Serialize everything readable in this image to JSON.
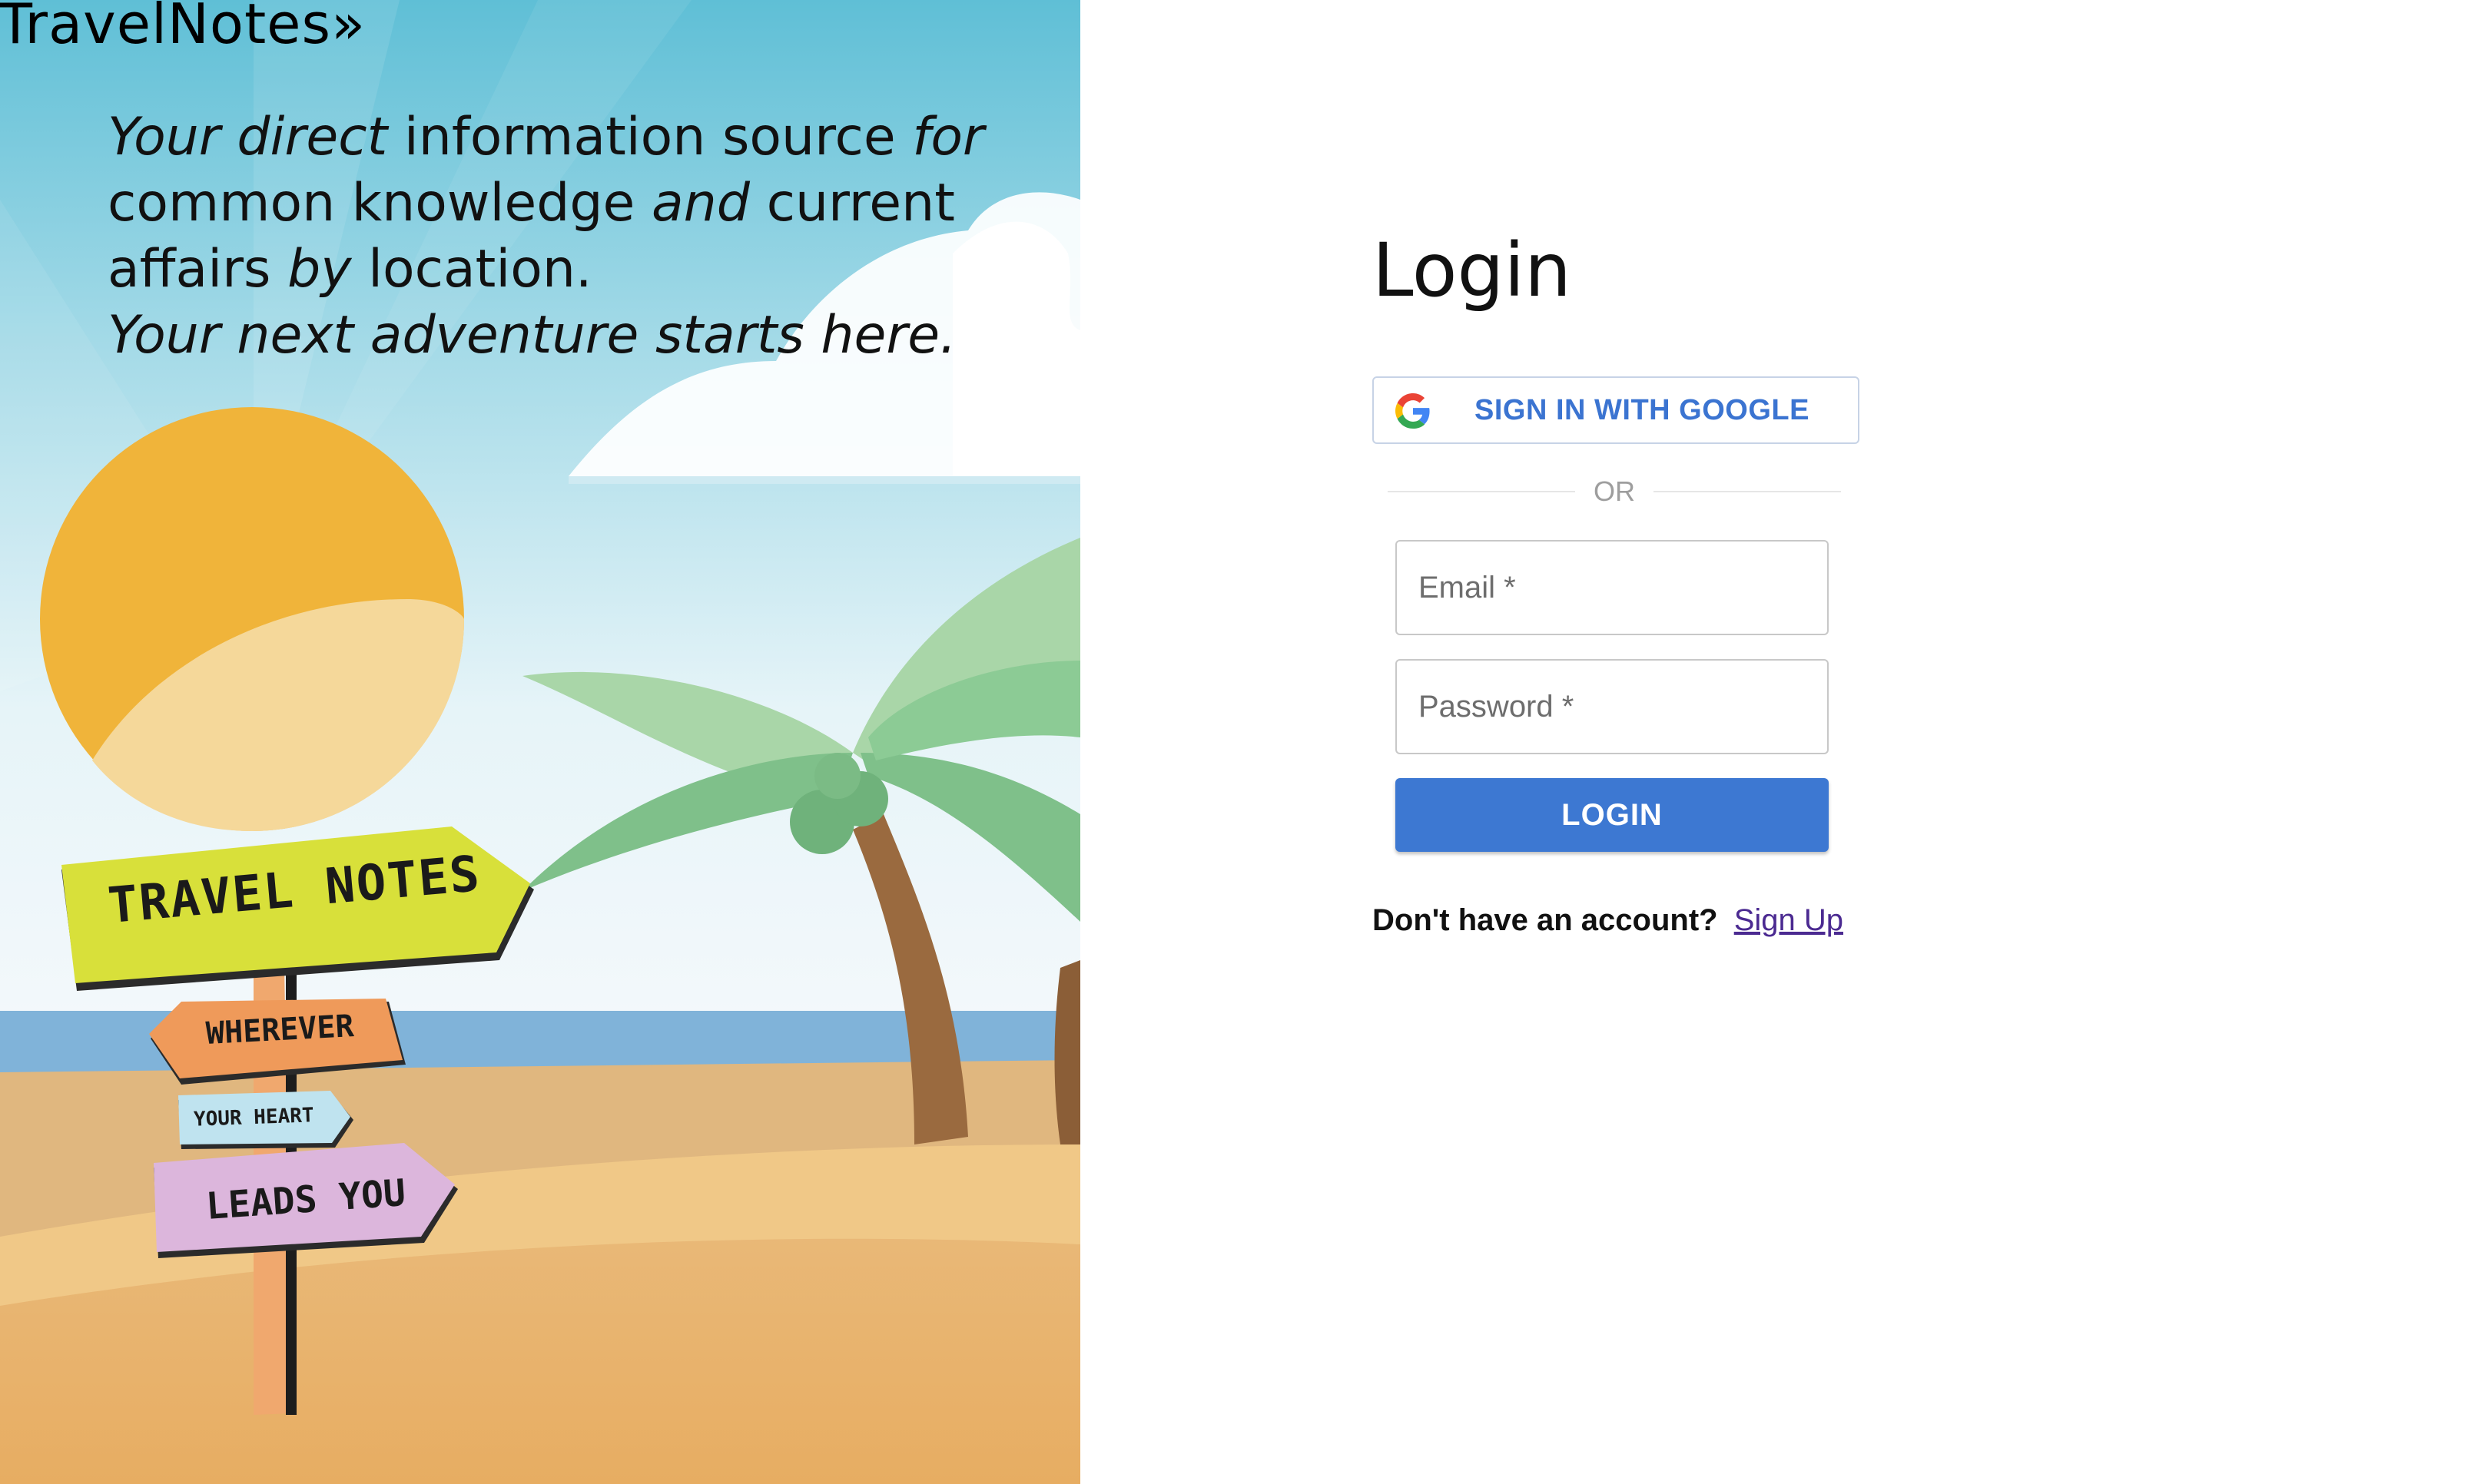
{
  "brand": {
    "name": "TravelNotes»"
  },
  "hero": {
    "tagline": {
      "part1": "Your direct",
      "part2": "information source",
      "part3": "for",
      "part4": "common knowledge",
      "part5": "and",
      "part6": "current affairs",
      "part7": "by",
      "part8": "location.",
      "part9": "Your next adventure starts here."
    },
    "signpost": {
      "sign1": "TRAVEL NOTES",
      "sign2": "WHEREVER",
      "sign3": "YOUR HEART",
      "sign4": "LEADS YOU"
    }
  },
  "login": {
    "title": "Login",
    "google_button_label": "SIGN IN WITH GOOGLE",
    "separator": "OR",
    "email_placeholder": "Email *",
    "password_placeholder": "Password *",
    "submit_label": "LOGIN",
    "signup_prompt": "Don't have an account?",
    "signup_link": "Sign Up"
  },
  "colors": {
    "primary_button": "#3d78d2",
    "google_text": "#3b74d1",
    "link": "#4b2a91",
    "sky": "#6cc3d8",
    "sun": "#f0b43a",
    "sand": "#efbd72"
  }
}
